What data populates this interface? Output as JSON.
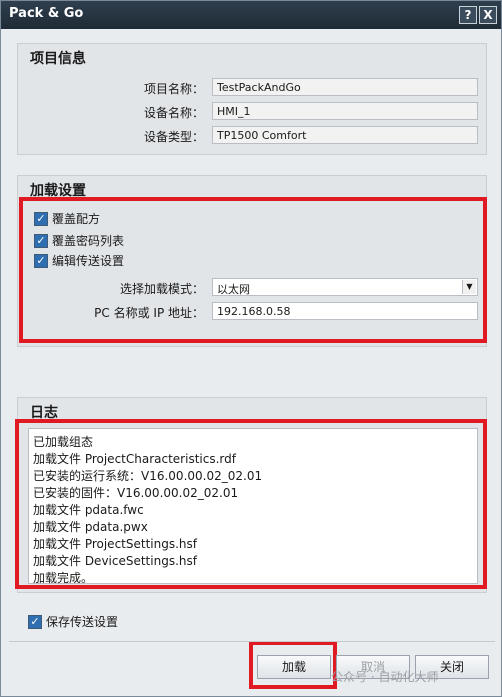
{
  "window": {
    "title": "Pack & Go",
    "help_glyph": "?",
    "close_glyph": "X"
  },
  "project_info": {
    "title": "项目信息",
    "rows": [
      {
        "label": "项目名称：",
        "value": "TestPackAndGo"
      },
      {
        "label": "设备名称：",
        "value": "HMI_1"
      },
      {
        "label": "设备类型：",
        "value": "TP1500 Comfort"
      }
    ]
  },
  "load_settings": {
    "title": "加载设置",
    "checkboxes": [
      {
        "label": "覆盖配方",
        "checked": true
      },
      {
        "label": "覆盖密码列表",
        "checked": true
      },
      {
        "label": "编辑传送设置",
        "checked": true
      }
    ],
    "mode_label": "选择加载模式：",
    "mode_value": "以太网",
    "address_label": "PC 名称或 IP 地址：",
    "address_value": "192.168.0.58"
  },
  "log": {
    "title": "日志",
    "lines": [
      "已加载组态",
      "加载文件 ProjectCharacteristics.rdf",
      "已安装的运行系统：V16.00.00.02_02.01",
      "已安装的固件：V16.00.00.02_02.01",
      "加载文件 pdata.fwc",
      "加载文件 pdata.pwx",
      "加载文件 ProjectSettings.hsf",
      "加载文件 DeviceSettings.hsf",
      "加载完成。"
    ]
  },
  "save_transfer": {
    "label": "保存传送设置",
    "checked": true
  },
  "buttons": {
    "load": "加载",
    "cancel": "取消",
    "close": "关闭"
  },
  "watermark": "公众号 · 自动化大师",
  "colors": {
    "highlight": "#e01a22",
    "titlebar": "#2f3f4e",
    "checkbox": "#2f6fb1"
  }
}
